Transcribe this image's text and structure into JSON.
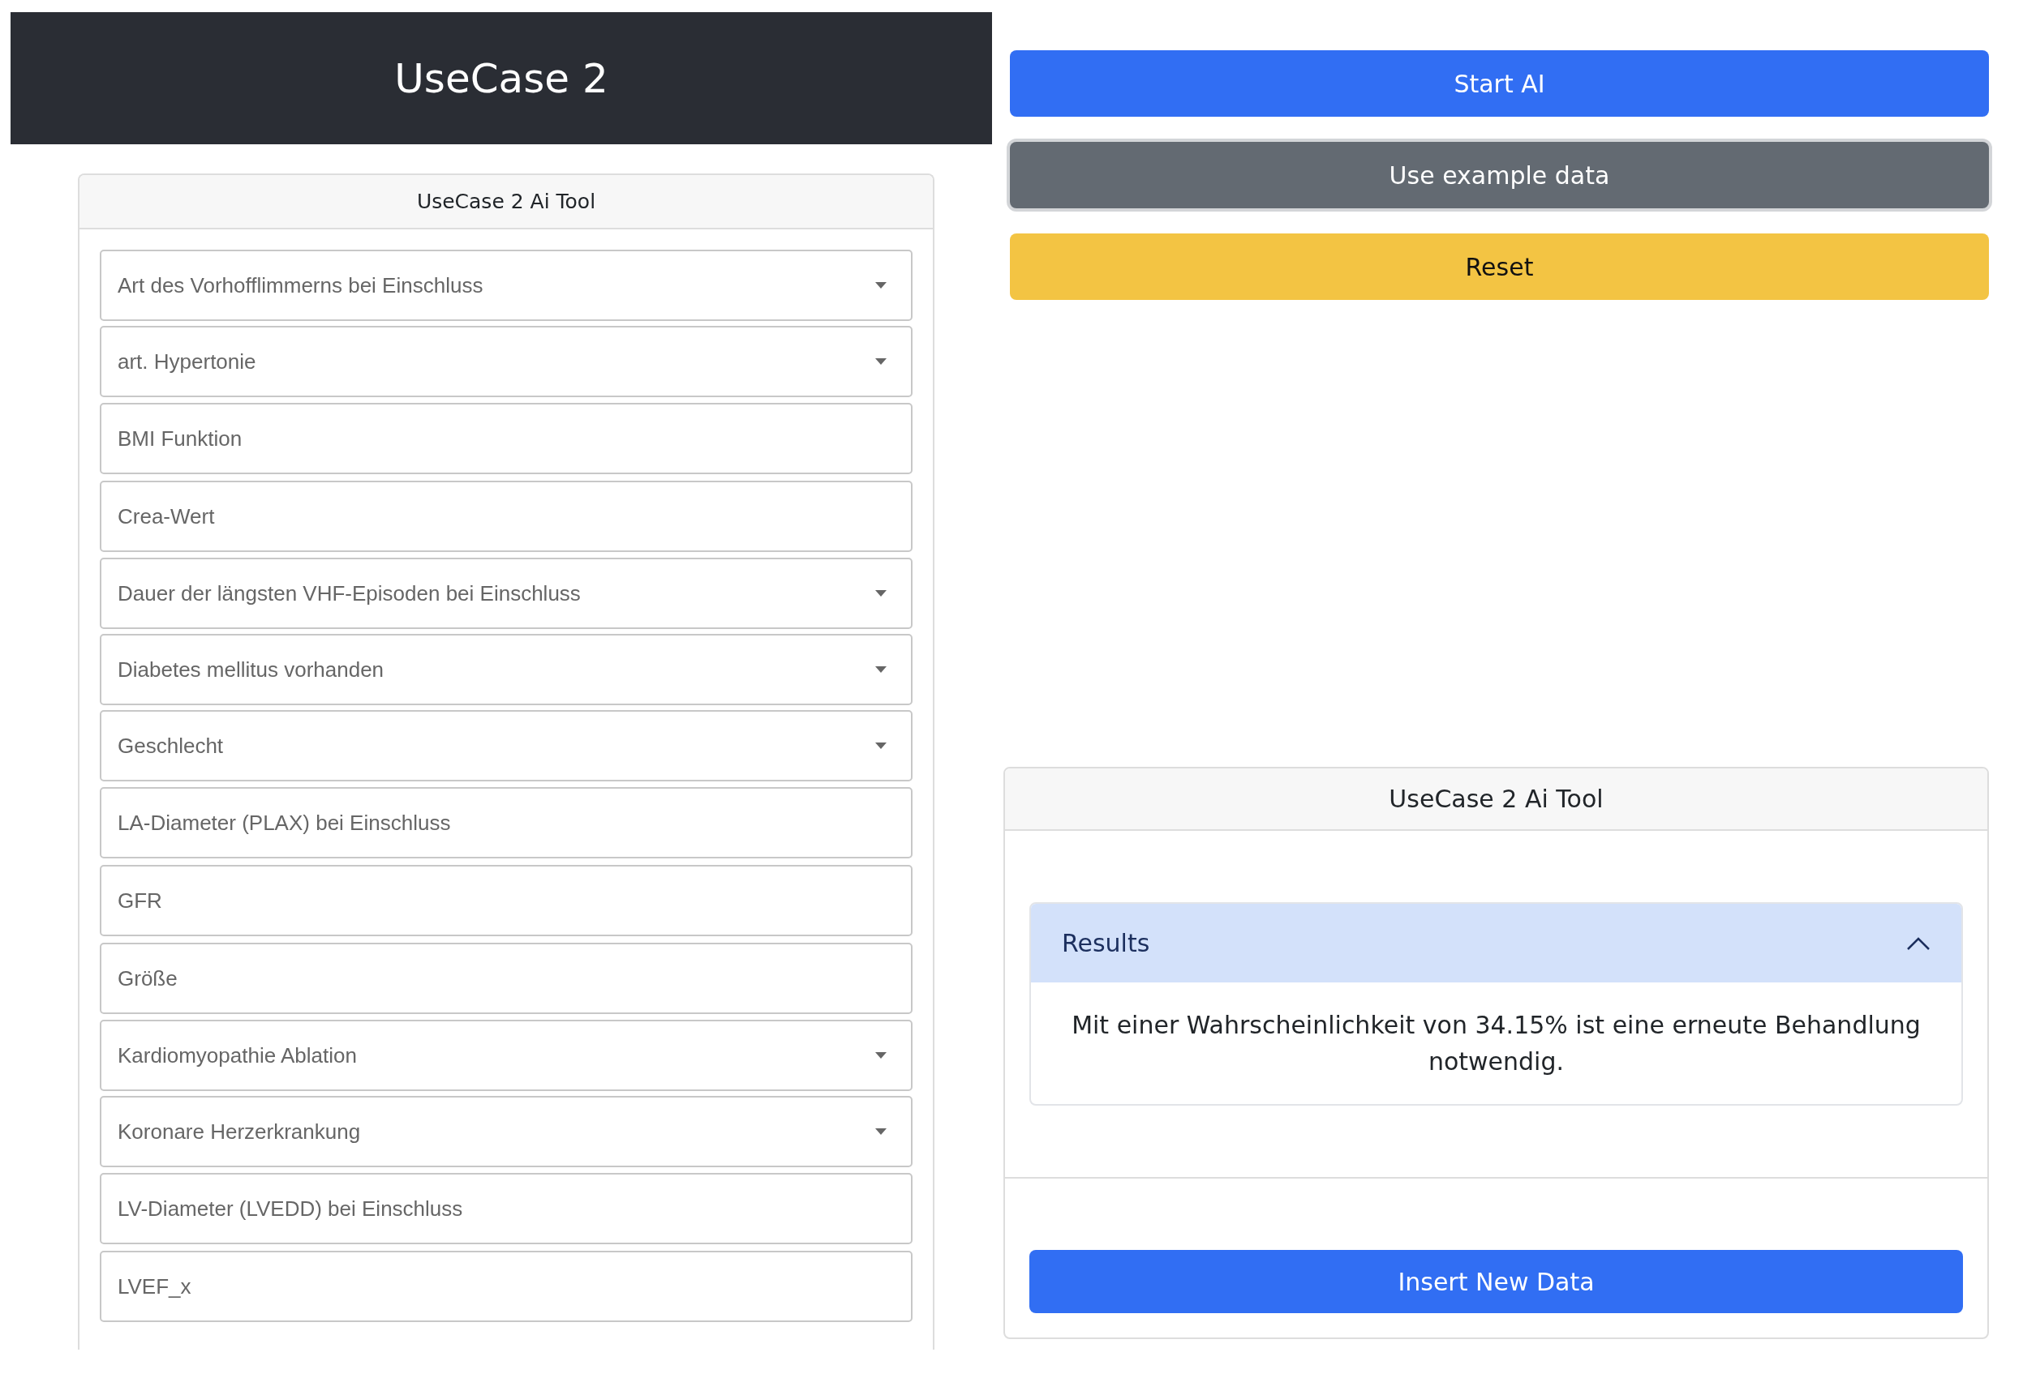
{
  "header": {
    "title": "UseCase 2"
  },
  "form": {
    "title": "UseCase 2 Ai Tool",
    "fields": [
      {
        "kind": "select",
        "placeholder": "Art des Vorhofflimmerns bei Einschluss"
      },
      {
        "kind": "select",
        "placeholder": "art. Hypertonie"
      },
      {
        "kind": "input",
        "placeholder": "BMI Funktion"
      },
      {
        "kind": "input",
        "placeholder": "Crea-Wert"
      },
      {
        "kind": "select",
        "placeholder": "Dauer der längsten VHF-Episoden bei Einschluss"
      },
      {
        "kind": "select",
        "placeholder": "Diabetes mellitus vorhanden"
      },
      {
        "kind": "select",
        "placeholder": "Geschlecht"
      },
      {
        "kind": "input",
        "placeholder": "LA-Diameter (PLAX) bei Einschluss"
      },
      {
        "kind": "input",
        "placeholder": "GFR"
      },
      {
        "kind": "input",
        "placeholder": "Größe"
      },
      {
        "kind": "select",
        "placeholder": "Kardiomyopathie Ablation"
      },
      {
        "kind": "select",
        "placeholder": "Koronare Herzerkrankung"
      },
      {
        "kind": "input",
        "placeholder": "LV-Diameter (LVEDD) bei Einschluss"
      },
      {
        "kind": "input",
        "placeholder": "LVEF_x"
      }
    ]
  },
  "actions": [
    {
      "label": "Start AI",
      "focused": false
    },
    {
      "label": "Use example data",
      "focused": true
    },
    {
      "label": "Reset",
      "focused": false
    }
  ],
  "result_card": {
    "title": "UseCase 2 Ai Tool",
    "accordion": {
      "title": "Results",
      "expanded": true,
      "text": "Mit einer Wahrscheinlichkeit von 34.15% ist eine erneute Behandlung notwendig."
    },
    "button": "Insert New Data"
  }
}
